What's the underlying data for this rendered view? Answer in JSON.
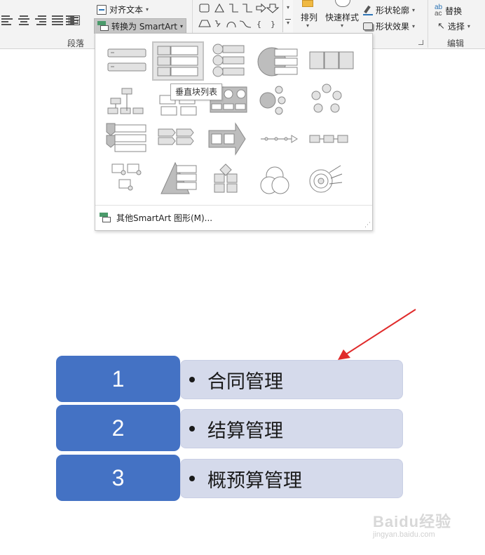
{
  "ribbon": {
    "align_text_label": "对齐文本",
    "convert_smartart_label": "转换为 SmartArt",
    "paragraph_group_label": "段落",
    "arrange_label": "排列",
    "quick_styles_label": "快速样式",
    "shape_outline_label": "形状轮廓",
    "shape_effects_label": "形状效果",
    "replace_label": "替换",
    "select_label": "选择",
    "editing_group_label": "编辑"
  },
  "gallery": {
    "tooltip": "垂直块列表",
    "more_smartart_label": "其他SmartArt 图形(M)..."
  },
  "slide": {
    "items": [
      {
        "number": "1",
        "text": "合同管理"
      },
      {
        "number": "2",
        "text": "结算管理"
      },
      {
        "number": "3",
        "text": "概预算管理"
      }
    ]
  },
  "watermark": {
    "main": "Baidu经验",
    "sub": "jingyan.baidu.com"
  },
  "colors": {
    "accent": "#4472c4",
    "accent_light": "#d5daeb",
    "arrow": "#e02b2b"
  }
}
